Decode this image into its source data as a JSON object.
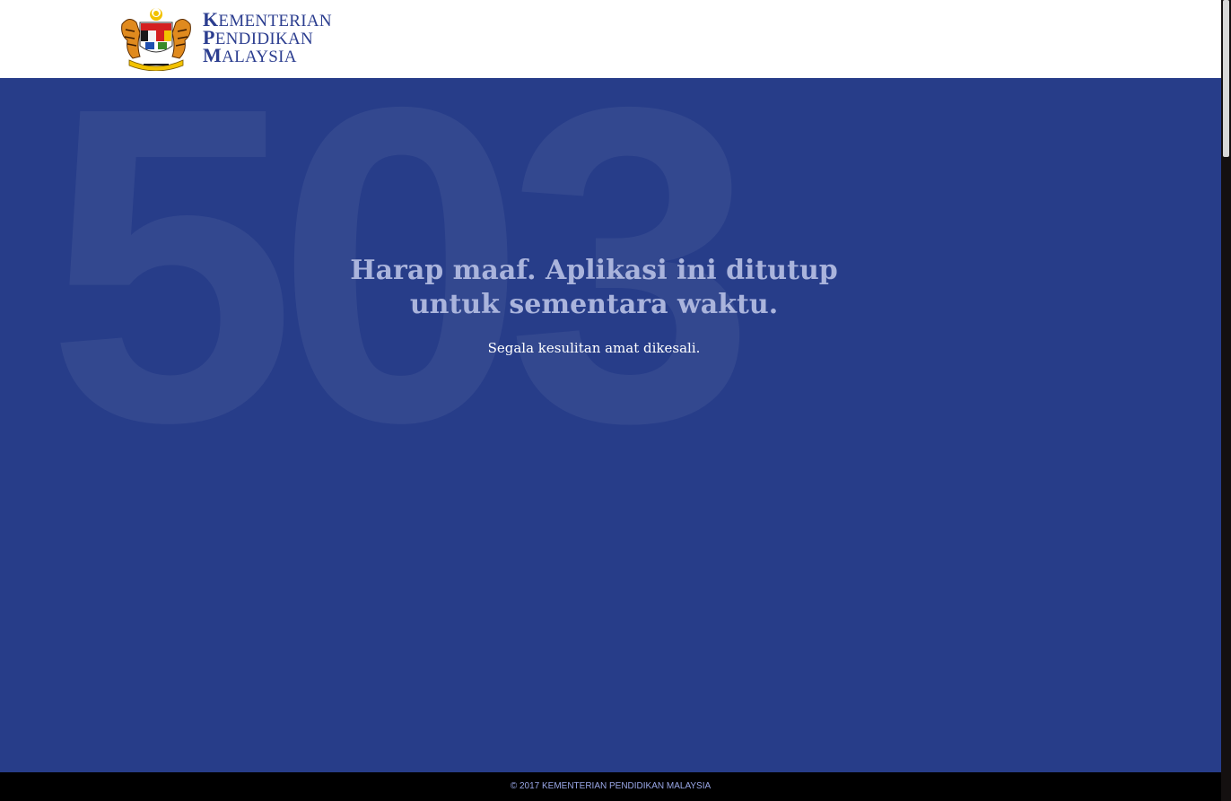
{
  "header": {
    "logo_lines": [
      "KEMENTERIAN",
      "PENDIDIKAN",
      "MALAYSIA"
    ],
    "crest_icon": "malaysia-coat-of-arms-icon"
  },
  "main": {
    "background_code": "503",
    "heading": "Harap maaf. Aplikasi ini ditutup untuk sementara waktu.",
    "subtext": "Segala kesulitan amat dikesali."
  },
  "footer": {
    "text": "© 2017 KEMENTERIAN PENDIDIKAN MALAYSIA"
  },
  "colors": {
    "main_background": "#273d89",
    "logo_text": "#2b3d8f",
    "heading": "#aab4dc",
    "footer_text": "#9aa8e8"
  }
}
